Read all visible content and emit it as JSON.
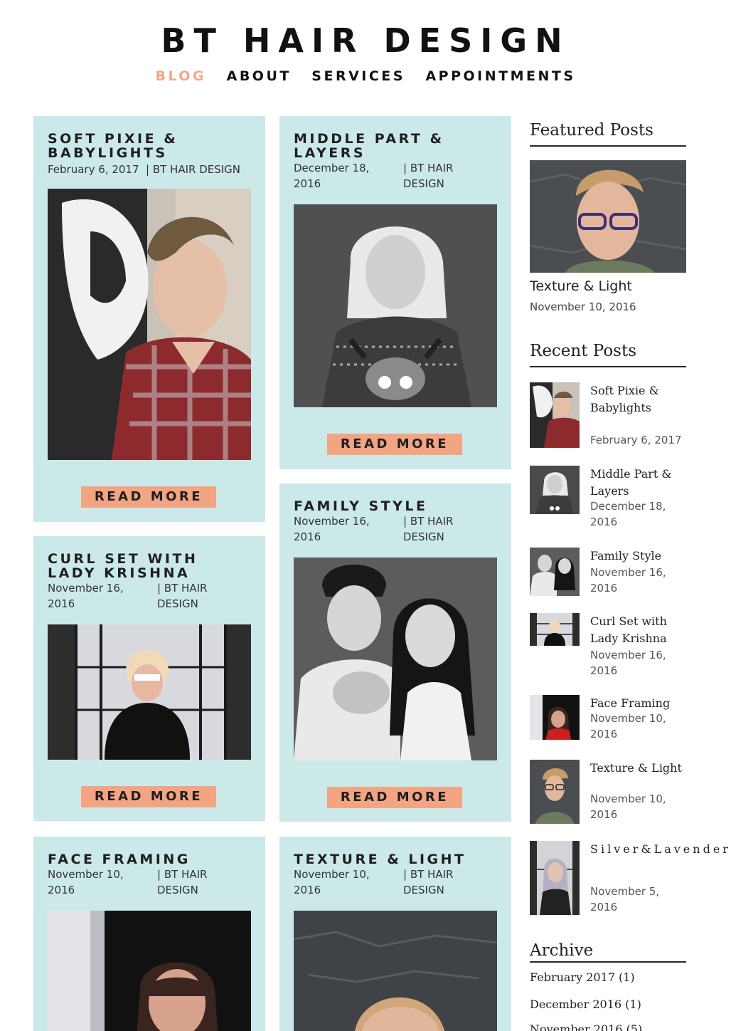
{
  "site": {
    "title": "BT HAIR DESIGN"
  },
  "nav": {
    "items": [
      "BLOG",
      "ABOUT",
      "SERVICES",
      "APPOINTMENTS"
    ],
    "active": "BLOG"
  },
  "posts": [
    {
      "title": "SOFT PIXIE & BABYLIGHTS",
      "date": "February 6, 2017",
      "author": "| BT HAIR DESIGN",
      "read_more": "READ MORE"
    },
    {
      "title": "MIDDLE PART & LAYERS",
      "date": "December 18, 2016",
      "author": "| BT HAIR DESIGN",
      "read_more": "READ MORE"
    },
    {
      "title": "CURL SET WITH LADY KRISHNA",
      "date": "November 16, 2016",
      "author": "| BT HAIR DESIGN",
      "read_more": "READ MORE"
    },
    {
      "title": "FAMILY STYLE",
      "date": "November 16, 2016",
      "author": "| BT HAIR DESIGN",
      "read_more": "READ MORE"
    },
    {
      "title": "FACE FRAMING",
      "date": "November 10, 2016",
      "author": "| BT HAIR DESIGN"
    },
    {
      "title": "TEXTURE & LIGHT",
      "date": "November 10, 2016",
      "author": "| BT HAIR DESIGN"
    }
  ],
  "sidebar": {
    "featured_heading": "Featured Posts",
    "featured": {
      "title": "Texture & Light",
      "date": "November 10, 2016"
    },
    "recent_heading": "Recent Posts",
    "recent": [
      {
        "title": "Soft Pixie & Babylights",
        "date": "February 6, 2017"
      },
      {
        "title": "Middle Part & Layers",
        "date": "December 18, 2016"
      },
      {
        "title": "Family Style",
        "date": "November 16, 2016"
      },
      {
        "title": "Curl Set with Lady Krishna",
        "date": "November 16, 2016"
      },
      {
        "title": "Face Framing",
        "date": "November 10, 2016"
      },
      {
        "title": "Texture & Light",
        "date": "November 10, 2016"
      },
      {
        "title": "Silver&Lavender",
        "date": "November 5, 2016"
      }
    ],
    "archive_heading": "Archive",
    "archive": [
      "February 2017 (1)",
      "December 2016 (1)",
      "November 2016 (5)"
    ]
  },
  "colors": {
    "card_bg": "#cce9ea",
    "accent": "#f3a583",
    "nav_active": "#f0a98a"
  }
}
